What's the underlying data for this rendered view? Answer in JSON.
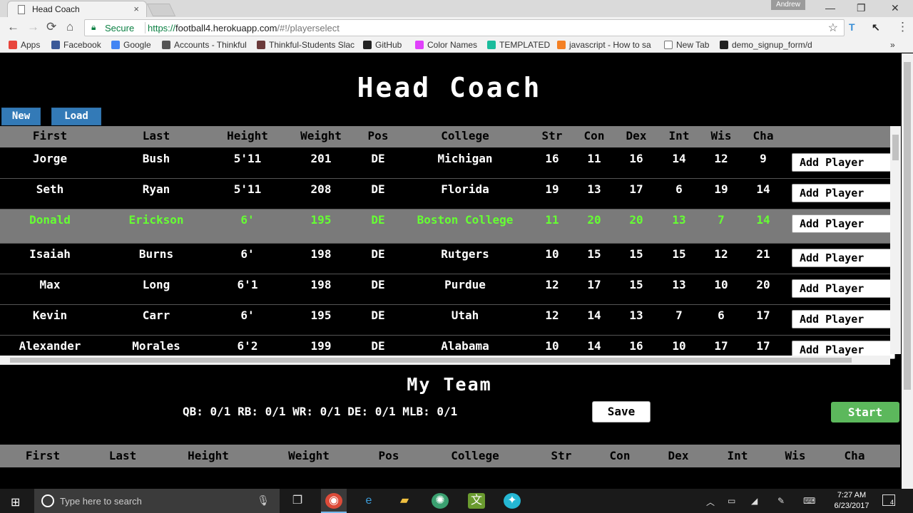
{
  "browser": {
    "tab_title": "Head Coach",
    "tab_close": "×",
    "profile": "Andrew",
    "window_buttons": [
      "—",
      "❐",
      "✕"
    ],
    "nav": {
      "back": "←",
      "forward": "→",
      "reload": "⟳",
      "home": "⌂"
    },
    "secure_label": "Secure",
    "url_scheme": "https://",
    "url_host": "football4.herokuapp.com",
    "url_path": "/#!/playerselect",
    "star": "☆",
    "menu": "⋮",
    "bookmarks": [
      {
        "label": "Apps",
        "color": "#e8453c"
      },
      {
        "label": "Facebook",
        "color": "#3b5998"
      },
      {
        "label": "Google",
        "color": "#4285f4"
      },
      {
        "label": "Accounts - Thinkful",
        "color": "#555555"
      },
      {
        "label": "Thinkful-Students Slac",
        "color": "#6b3a3a"
      },
      {
        "label": "GitHub",
        "color": "#222222"
      },
      {
        "label": "Color Names",
        "color": "#e040fb"
      },
      {
        "label": "TEMPLATED",
        "color": "#1abc9c"
      },
      {
        "label": "javascript - How to sa",
        "color": "#f48024"
      },
      {
        "label": "New Tab",
        "color": "#ffffff"
      },
      {
        "label": "demo_signup_form/d",
        "color": "#222222"
      }
    ],
    "more": "»"
  },
  "app": {
    "title": "Head Coach",
    "new_label": "New",
    "load_label": "Load",
    "add_label": "Add Player",
    "columns": [
      "First",
      "Last",
      "Height",
      "Weight",
      "Pos",
      "College",
      "Str",
      "Con",
      "Dex",
      "Int",
      "Wis",
      "Cha"
    ],
    "players": [
      {
        "first": "Jorge",
        "last": "Bush",
        "height": "5'11",
        "weight": "201",
        "pos": "DE",
        "college": "Michigan",
        "str": "16",
        "con": "11",
        "dex": "16",
        "int": "14",
        "wis": "12",
        "cha": "9"
      },
      {
        "first": "Seth",
        "last": "Ryan",
        "height": "5'11",
        "weight": "208",
        "pos": "DE",
        "college": "Florida",
        "str": "19",
        "con": "13",
        "dex": "17",
        "int": "6",
        "wis": "19",
        "cha": "14"
      },
      {
        "first": "Donald",
        "last": "Erickson",
        "height": "6'",
        "weight": "195",
        "pos": "DE",
        "college": "Boston College",
        "str": "11",
        "con": "20",
        "dex": "20",
        "int": "13",
        "wis": "7",
        "cha": "14"
      },
      {
        "first": "Isaiah",
        "last": "Burns",
        "height": "6'",
        "weight": "198",
        "pos": "DE",
        "college": "Rutgers",
        "str": "10",
        "con": "15",
        "dex": "15",
        "int": "15",
        "wis": "12",
        "cha": "21"
      },
      {
        "first": "Max",
        "last": "Long",
        "height": "6'1",
        "weight": "198",
        "pos": "DE",
        "college": "Purdue",
        "str": "12",
        "con": "17",
        "dex": "15",
        "int": "13",
        "wis": "10",
        "cha": "20"
      },
      {
        "first": "Kevin",
        "last": "Carr",
        "height": "6'",
        "weight": "195",
        "pos": "DE",
        "college": "Utah",
        "str": "12",
        "con": "14",
        "dex": "13",
        "int": "7",
        "wis": "6",
        "cha": "17"
      },
      {
        "first": "Alexander",
        "last": "Morales",
        "height": "6'2",
        "weight": "199",
        "pos": "DE",
        "college": "Alabama",
        "str": "10",
        "con": "14",
        "dex": "16",
        "int": "10",
        "wis": "17",
        "cha": "17"
      }
    ],
    "team_title": "My Team",
    "position_counts": "QB: 0/1 RB: 0/1 WR: 0/1 DE: 0/1 MLB: 0/1",
    "save_label": "Save",
    "start_label": "Start",
    "team_columns": [
      "First",
      "Last",
      "Height",
      "Weight",
      "Pos",
      "College",
      "Str",
      "Con",
      "Dex",
      "Int",
      "Wis",
      "Cha"
    ]
  },
  "taskbar": {
    "search_placeholder": "Type here to search",
    "time": "7:27 AM",
    "date": "6/23/2017",
    "notifications": "4",
    "apps": [
      "chrome-icon",
      "edge-icon",
      "file-explorer-icon",
      "globe-icon",
      "sublime-icon",
      "app-icon"
    ]
  },
  "colors": {
    "selected_row_text": "#66ff33",
    "header_gray": "#808080",
    "primary_button": "#337ab7",
    "start_button": "#5cb85c"
  }
}
